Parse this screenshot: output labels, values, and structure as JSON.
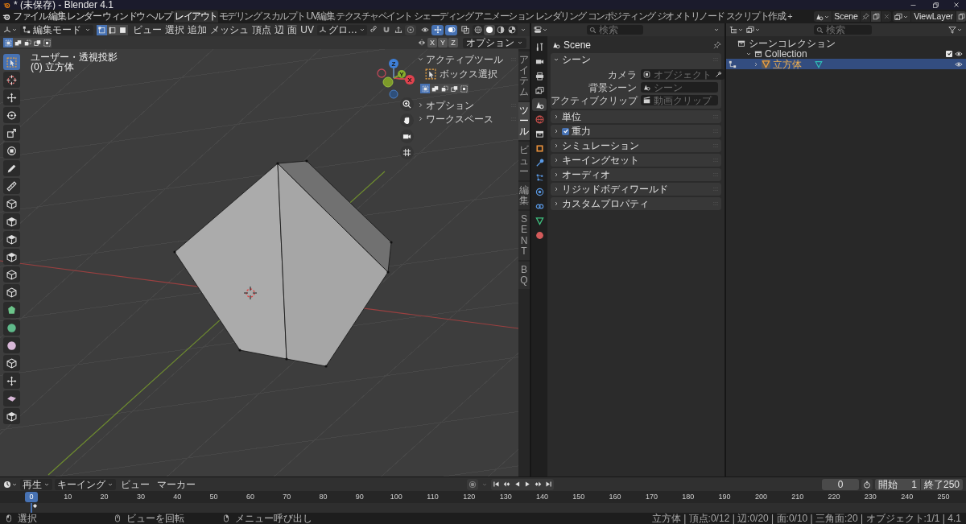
{
  "window": {
    "title": "* (未保存) - Blender 4.1"
  },
  "menus": [
    "ファイル",
    "編集",
    "レンダー",
    "ウィンドウ",
    "ヘルプ"
  ],
  "workspaces": [
    {
      "label": "レイアウト",
      "selected": true
    },
    {
      "label": "モデリング",
      "selected": false
    },
    {
      "label": "スカルプト",
      "selected": false
    },
    {
      "label": "UV編集",
      "selected": false
    },
    {
      "label": "テクスチャペイント",
      "selected": false
    },
    {
      "label": "シェーディング",
      "selected": false
    },
    {
      "label": "アニメーション",
      "selected": false
    },
    {
      "label": "レンダリング",
      "selected": false
    },
    {
      "label": "コンポジティング",
      "selected": false
    },
    {
      "label": "ジオメトリノード",
      "selected": false
    },
    {
      "label": "スクリプト作成",
      "selected": false
    }
  ],
  "add_workspace": "+",
  "scene": "Scene",
  "view_layer": "ViewLayer",
  "viewport": {
    "mode": "編集モード",
    "select_modes": [
      {
        "kind": "vertex",
        "selected": true
      },
      {
        "kind": "edge",
        "selected": false
      },
      {
        "kind": "face",
        "selected": false
      }
    ],
    "menus": [
      "ビュー",
      "選択",
      "追加",
      "メッシュ",
      "頂点",
      "辺",
      "面",
      "UV"
    ],
    "orientation": "グロ…",
    "shading": [
      {
        "kind": "wireframe",
        "selected": false
      },
      {
        "kind": "solid",
        "selected": true
      },
      {
        "kind": "material",
        "selected": false
      },
      {
        "kind": "rendered",
        "selected": false
      }
    ],
    "box_modes": [
      {
        "kind": "set",
        "selected": true
      },
      {
        "kind": "extend",
        "selected": false
      },
      {
        "kind": "subtract",
        "selected": false
      },
      {
        "kind": "invert",
        "selected": false
      },
      {
        "kind": "intersect",
        "selected": false
      }
    ],
    "mirror_axes": [
      {
        "label": "X",
        "selected": false
      },
      {
        "label": "Y",
        "selected": false
      },
      {
        "label": "Z",
        "selected": false
      }
    ],
    "options": "オプション",
    "view_name": "ユーザー・透視投影",
    "object_name": "(0) 立方体",
    "tools": [
      {
        "kind": "select",
        "selected": true
      },
      {
        "kind": "cursor",
        "selected": false
      },
      {
        "kind": "move",
        "selected": false
      },
      {
        "kind": "rotate",
        "selected": false
      },
      {
        "kind": "scale",
        "selected": false
      },
      {
        "kind": "transform",
        "selected": false
      },
      {
        "kind": "annotate",
        "selected": false
      },
      {
        "kind": "measure",
        "selected": false
      },
      {
        "kind": "add_cube",
        "selected": false
      },
      {
        "kind": "extrude",
        "selected": false
      },
      {
        "kind": "inset",
        "selected": false
      },
      {
        "kind": "bevel",
        "selected": false
      },
      {
        "kind": "loop_cut",
        "selected": false
      },
      {
        "kind": "knife",
        "selected": false
      },
      {
        "kind": "poly_build",
        "selected": false
      },
      {
        "kind": "spin",
        "selected": false
      },
      {
        "kind": "smooth",
        "selected": false
      },
      {
        "kind": "shrink",
        "selected": false
      },
      {
        "kind": "shear",
        "selected": false
      },
      {
        "kind": "to_sphere",
        "selected": false
      },
      {
        "kind": "rip",
        "selected": false
      }
    ],
    "gizmo_axes": [
      "X",
      "Y",
      "Z"
    ],
    "sidebar": {
      "tabs": [
        {
          "label": "アイテム",
          "selected": false
        },
        {
          "label": "ツール",
          "selected": true
        },
        {
          "label": "ビュー",
          "selected": false
        },
        {
          "label": "編集",
          "selected": false
        },
        {
          "label": "SENT",
          "selected": false
        },
        {
          "label": "BQ",
          "selected": false
        }
      ],
      "active_tool": {
        "title": "アクティブツール",
        "expanded": true,
        "tool": "ボックス選択",
        "modes": [
          {
            "kind": "set",
            "selected": true
          },
          {
            "kind": "extend",
            "selected": false
          },
          {
            "kind": "subtract",
            "selected": false
          },
          {
            "kind": "invert",
            "selected": false
          },
          {
            "kind": "intersect",
            "selected": false
          }
        ]
      },
      "sections": [
        {
          "title": "オプション",
          "expanded": false
        },
        {
          "title": "ワークスペース",
          "expanded": false
        }
      ]
    }
  },
  "properties": {
    "search_placeholder": "検索",
    "tabs": [
      {
        "kind": "tool",
        "selected": false
      },
      {
        "kind": "render",
        "selected": false
      },
      {
        "kind": "output",
        "selected": false
      },
      {
        "kind": "view_layer",
        "selected": false
      },
      {
        "kind": "scene",
        "selected": true
      },
      {
        "kind": "world",
        "selected": false
      },
      {
        "kind": "collection",
        "selected": false
      },
      {
        "kind": "object",
        "selected": false
      },
      {
        "kind": "modifiers",
        "selected": false
      },
      {
        "kind": "particles",
        "selected": false
      },
      {
        "kind": "physics",
        "selected": false
      },
      {
        "kind": "constraints",
        "selected": false
      },
      {
        "kind": "data",
        "selected": false
      },
      {
        "kind": "material",
        "selected": false
      }
    ],
    "context": "Scene",
    "panels": [
      {
        "title": "シーン",
        "kind": "plain",
        "expanded": true,
        "fields": [
          {
            "label": "カメラ",
            "kind": "object",
            "placeholder": "オブジェクト"
          },
          {
            "label": "背景シーン",
            "kind": "scene",
            "placeholder": "シーン"
          },
          {
            "label": "アクティブクリップ",
            "kind": "clip",
            "placeholder": "動画クリップ"
          }
        ]
      },
      {
        "title": "単位",
        "kind": "plain",
        "expanded": false
      },
      {
        "title": "重力",
        "kind": "toggle",
        "expanded": false,
        "checked": true
      },
      {
        "title": "シミュレーション",
        "kind": "plain",
        "expanded": false
      },
      {
        "title": "キーイングセット",
        "kind": "plain",
        "expanded": false
      },
      {
        "title": "オーディオ",
        "kind": "plain",
        "expanded": false
      },
      {
        "title": "リジッドボディワールド",
        "kind": "plain",
        "expanded": false
      },
      {
        "title": "カスタムプロパティ",
        "kind": "plain",
        "expanded": false
      }
    ]
  },
  "outliner": {
    "search_placeholder": "検索",
    "root": "シーンコレクション",
    "collections": [
      {
        "label": "Collection",
        "expanded": true,
        "checked": true,
        "objects": [
          {
            "label": "立方体",
            "expanded": false,
            "selected": true
          }
        ]
      }
    ]
  },
  "timeline": {
    "menus": [
      {
        "label": "再生",
        "dropdown": true
      },
      {
        "label": "キーイング",
        "dropdown": true
      },
      {
        "label": "ビュー",
        "dropdown": false
      },
      {
        "label": "マーカー",
        "dropdown": false
      }
    ],
    "current_frame": "0",
    "start_label": "開始",
    "start": "1",
    "end_label": "終了",
    "end": "250",
    "playhead": "0",
    "frames": [
      "10",
      "20",
      "30",
      "40",
      "50",
      "60",
      "70",
      "80",
      "90",
      "100",
      "110",
      "120",
      "130",
      "140",
      "150",
      "160",
      "170",
      "180",
      "190",
      "200",
      "210",
      "220",
      "230",
      "240",
      "250"
    ]
  },
  "status": {
    "hints": [
      {
        "kind": "left",
        "label": "選択"
      },
      {
        "kind": "middle",
        "label": "ビューを回転"
      },
      {
        "kind": "right",
        "label": "メニュー呼び出し"
      }
    ],
    "stats": "立方体 | 頂点:0/12 | 辺:0/20 | 面:0/10 | 三角面:20 | オブジェクト:1/1 | 4.1"
  }
}
